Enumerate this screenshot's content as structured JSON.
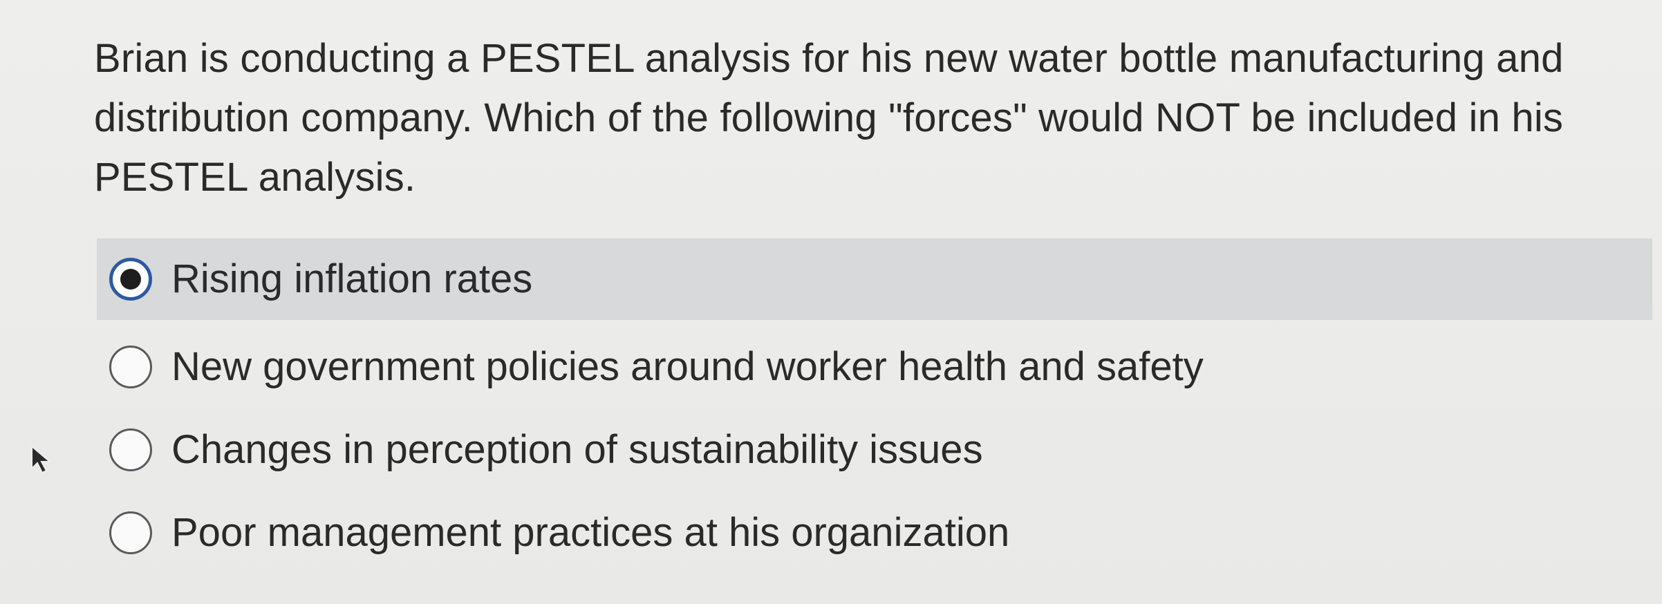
{
  "question": {
    "text": "Brian is conducting a PESTEL analysis for his new water bottle manufacturing and distribution company. Which of the following \"forces\" would NOT be included in his PESTEL analysis."
  },
  "options": [
    {
      "label": "Rising inflation rates",
      "selected": true
    },
    {
      "label": "New government policies around worker health and safety",
      "selected": false
    },
    {
      "label": "Changes in perception of sustainability issues",
      "selected": false
    },
    {
      "label": "Poor management practices at his organization",
      "selected": false
    }
  ],
  "colors": {
    "selected_row": "#d7d9da",
    "radio_selected_ring": "#2c5aa0"
  },
  "icons": {
    "cursor": "mouse-pointer-icon"
  }
}
